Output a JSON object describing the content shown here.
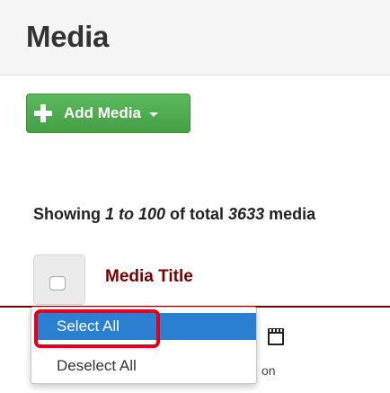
{
  "header": {
    "title": "Media"
  },
  "toolbar": {
    "add_media_label": "Add Media"
  },
  "summary": {
    "prefix": "Showing ",
    "range": "1 to 100",
    "middle": " of total ",
    "total": "3633",
    "suffix": " media"
  },
  "table": {
    "column_title": "Media Title",
    "partial_row_text": "on"
  },
  "select_menu": {
    "items": [
      {
        "label": "Select All",
        "state": "highlighted"
      },
      {
        "label": "Deselect All"
      }
    ]
  },
  "colors": {
    "add_button": "#5cb85c",
    "column_title": "#7a0000",
    "menu_highlight": "#2a7fd0",
    "annotation_box": "#e3001b"
  },
  "icons": [
    "plus-icon",
    "caret-down-icon",
    "checkbox-icon",
    "clapperboard-icon"
  ]
}
